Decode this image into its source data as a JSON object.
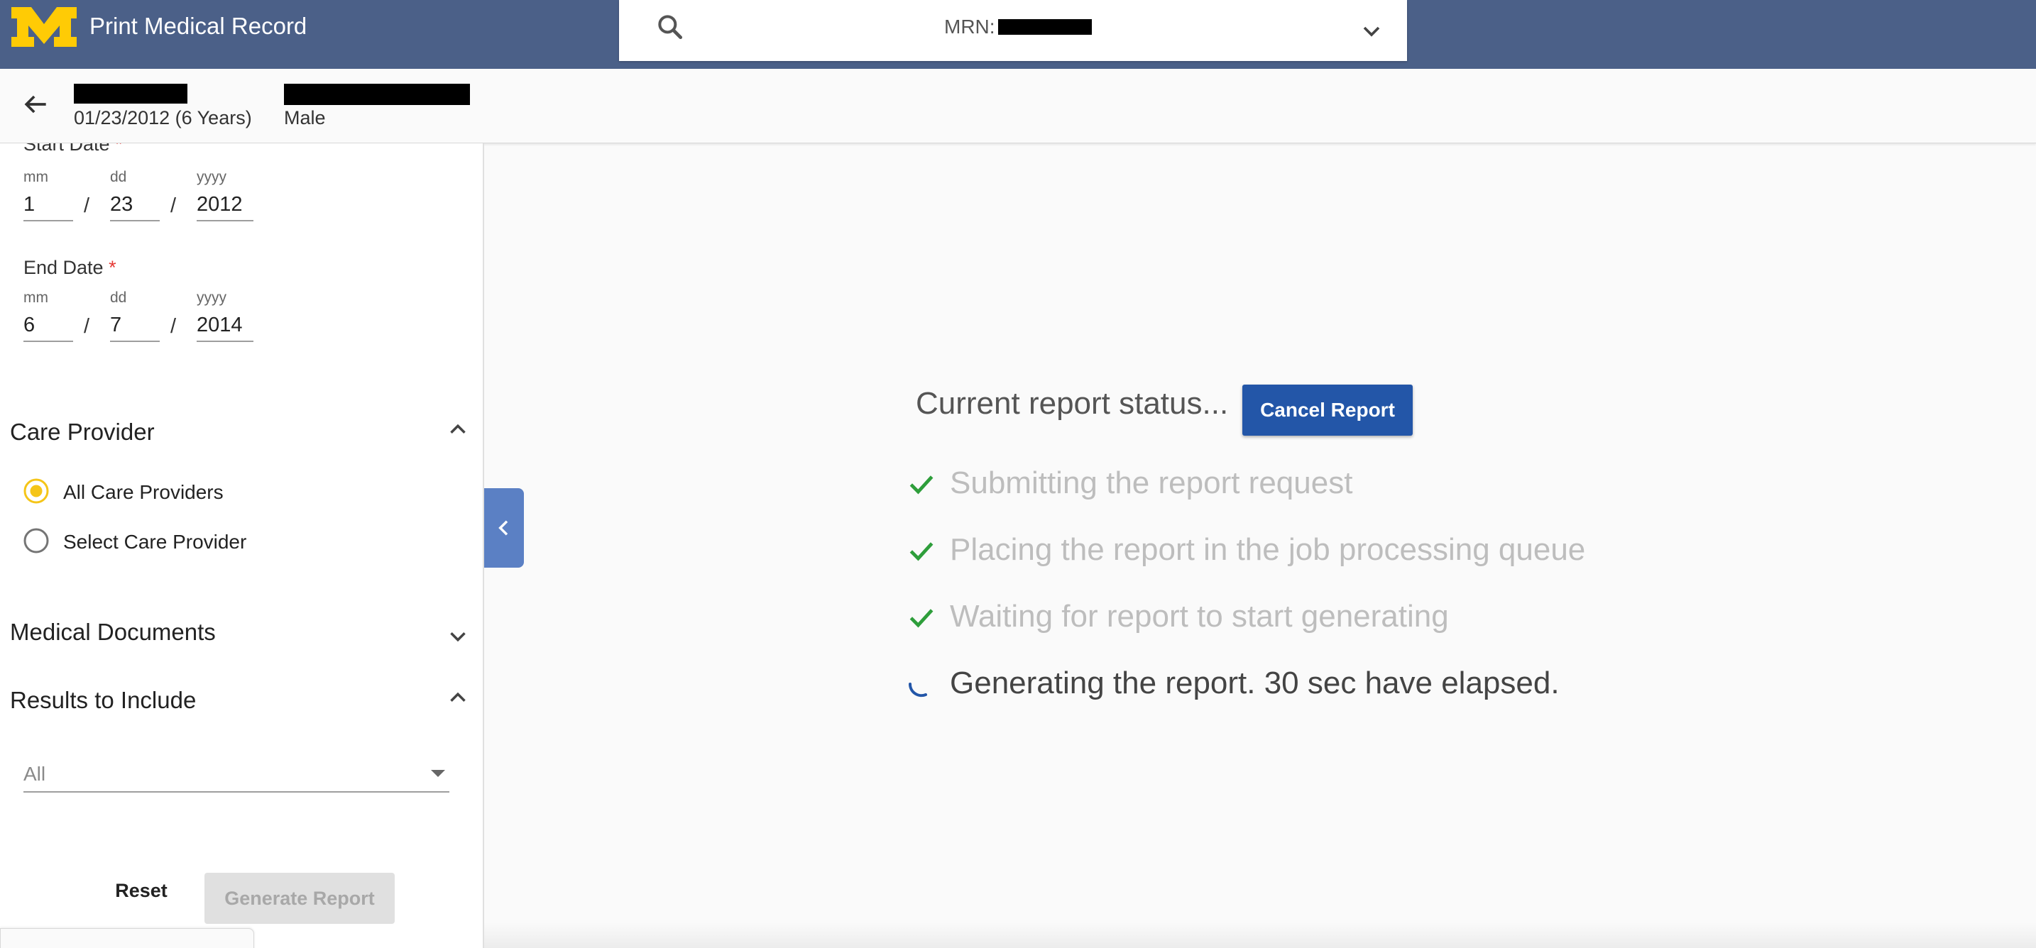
{
  "header": {
    "app_title": "Print Medical Record",
    "search": {
      "label": "MRN:"
    }
  },
  "patient": {
    "dob_age": "01/23/2012 (6 Years)",
    "sex": "Male"
  },
  "filters": {
    "start_date": {
      "label": "Start Date",
      "required_marker": "*",
      "mm_label": "mm",
      "dd_label": "dd",
      "yyyy_label": "yyyy",
      "mm": "1",
      "dd": "23",
      "yyyy": "2012"
    },
    "end_date": {
      "label": "End Date",
      "required_marker": "*",
      "mm_label": "mm",
      "dd_label": "dd",
      "yyyy_label": "yyyy",
      "mm": "6",
      "dd": "7",
      "yyyy": "2014"
    },
    "date_separator": "/",
    "care_provider": {
      "title": "Care Provider",
      "options": [
        {
          "label": "All Care Providers",
          "selected": true
        },
        {
          "label": "Select Care Provider",
          "selected": false
        }
      ]
    },
    "medical_documents": {
      "title": "Medical Documents"
    },
    "results_to_include": {
      "title": "Results to Include",
      "selected": "All"
    },
    "reset_label": "Reset",
    "generate_label": "Generate Report"
  },
  "report_status": {
    "title": "Current report status...",
    "cancel_label": "Cancel Report",
    "steps": [
      {
        "text": "Submitting the report request",
        "state": "done"
      },
      {
        "text": "Placing the report in the job processing queue",
        "state": "done"
      },
      {
        "text": "Waiting for report to start generating",
        "state": "done"
      },
      {
        "text": "Generating the report. 30 sec have elapsed.",
        "state": "in-progress"
      }
    ]
  },
  "colors": {
    "header_bg": "#4b6088",
    "logo_maize": "#ffcb05",
    "primary_button": "#2356a8",
    "check_green": "#2e9e3b",
    "spinner_blue": "#2356a8",
    "radio_selected": "#f5c518",
    "required": "#e53935"
  },
  "icons": {
    "search": "search-icon",
    "back": "arrow-left-icon",
    "collapse": "chevron-left-icon",
    "check": "check-icon",
    "spinner": "spinner-icon"
  }
}
